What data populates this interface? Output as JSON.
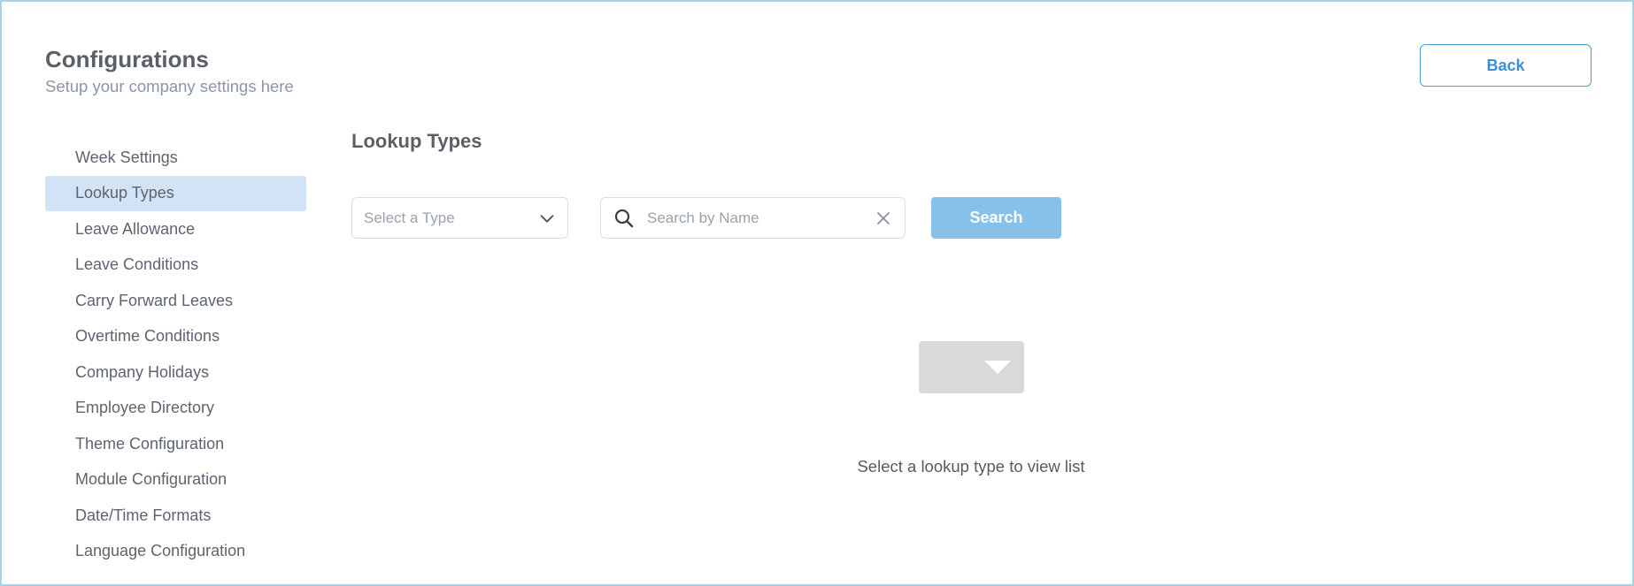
{
  "header": {
    "title": "Configurations",
    "subtitle": "Setup your company settings here",
    "back_label": "Back"
  },
  "sidebar": {
    "items": [
      {
        "label": "Week Settings",
        "active": false
      },
      {
        "label": "Lookup Types",
        "active": true
      },
      {
        "label": "Leave Allowance",
        "active": false
      },
      {
        "label": "Leave Conditions",
        "active": false
      },
      {
        "label": "Carry Forward Leaves",
        "active": false
      },
      {
        "label": "Overtime Conditions",
        "active": false
      },
      {
        "label": "Company Holidays",
        "active": false
      },
      {
        "label": "Employee Directory",
        "active": false
      },
      {
        "label": "Theme Configuration",
        "active": false
      },
      {
        "label": "Module Configuration",
        "active": false
      },
      {
        "label": "Date/Time Formats",
        "active": false
      },
      {
        "label": "Language Configuration",
        "active": false
      }
    ]
  },
  "main": {
    "section_title": "Lookup Types",
    "type_select": {
      "placeholder": "Select a Type",
      "icon": "chevron-down-icon"
    },
    "search": {
      "placeholder": "Search by Name",
      "value": "",
      "icon": "search-icon",
      "clear_icon": "close-icon"
    },
    "search_button_label": "Search",
    "empty_state": {
      "icon": "empty-folder-icon",
      "message": "Select a lookup type to view list"
    }
  },
  "colors": {
    "accent": "#3b8fd1",
    "search_button": "#86c1ea",
    "active_item_bg": "#d2e3f5",
    "frame_border": "#a9d3e4"
  }
}
